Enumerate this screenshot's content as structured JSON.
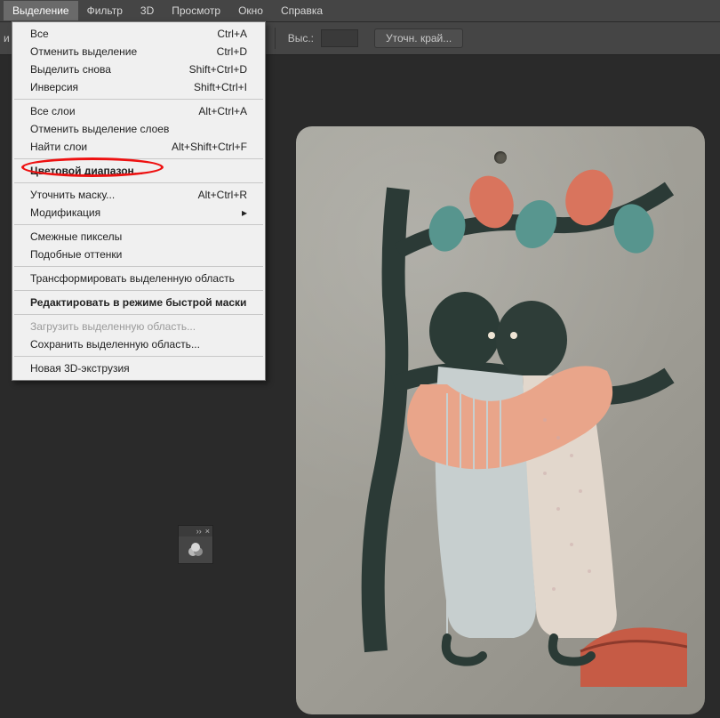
{
  "menubar": {
    "items": [
      "Выделение",
      "Фильтр",
      "3D",
      "Просмотр",
      "Окно",
      "Справка"
    ],
    "active_index": 0
  },
  "toolbar": {
    "partial_label": "и",
    "height_label": "Выс.:",
    "height_value": "",
    "refine_edge_label": "Уточн. край..."
  },
  "selection_menu": {
    "groups": [
      [
        {
          "label": "Все",
          "shortcut": "Ctrl+A",
          "enabled": true
        },
        {
          "label": "Отменить выделение",
          "shortcut": "Ctrl+D",
          "enabled": true
        },
        {
          "label": "Выделить снова",
          "shortcut": "Shift+Ctrl+D",
          "enabled": true
        },
        {
          "label": "Инверсия",
          "shortcut": "Shift+Ctrl+I",
          "enabled": true
        }
      ],
      [
        {
          "label": "Все слои",
          "shortcut": "Alt+Ctrl+A",
          "enabled": true
        },
        {
          "label": "Отменить выделение слоев",
          "shortcut": "",
          "enabled": true
        },
        {
          "label": "Найти слои",
          "shortcut": "Alt+Shift+Ctrl+F",
          "enabled": true
        }
      ],
      [
        {
          "label": "Цветовой диапазон...",
          "shortcut": "",
          "enabled": true,
          "bold": true,
          "highlighted": true
        }
      ],
      [
        {
          "label": "Уточнить маску...",
          "shortcut": "Alt+Ctrl+R",
          "enabled": true
        },
        {
          "label": "Модификация",
          "shortcut": "",
          "enabled": true,
          "submenu": true
        }
      ],
      [
        {
          "label": "Смежные пикселы",
          "shortcut": "",
          "enabled": true
        },
        {
          "label": "Подобные оттенки",
          "shortcut": "",
          "enabled": true
        }
      ],
      [
        {
          "label": "Трансформировать выделенную область",
          "shortcut": "",
          "enabled": true
        }
      ],
      [
        {
          "label": "Редактировать в режиме быстрой маски",
          "shortcut": "",
          "enabled": true,
          "bold": true
        }
      ],
      [
        {
          "label": "Загрузить выделенную область...",
          "shortcut": "",
          "enabled": false
        },
        {
          "label": "Сохранить выделенную область...",
          "shortcut": "",
          "enabled": true
        }
      ],
      [
        {
          "label": "Новая 3D-экструзия",
          "shortcut": "",
          "enabled": true
        }
      ]
    ]
  },
  "floating_panel": {
    "expand_icon": "expand-icon",
    "close_icon": "close-icon",
    "tool_icon": "color-wheel-icon"
  },
  "canvas": {
    "description": "Artwork on rounded wooden cutting board: two stylised dark-green figures kissing under patterned tree with coral and teal leaves; peach arm wrapping around; striped/dotted garments; coral wave pattern lower right."
  }
}
